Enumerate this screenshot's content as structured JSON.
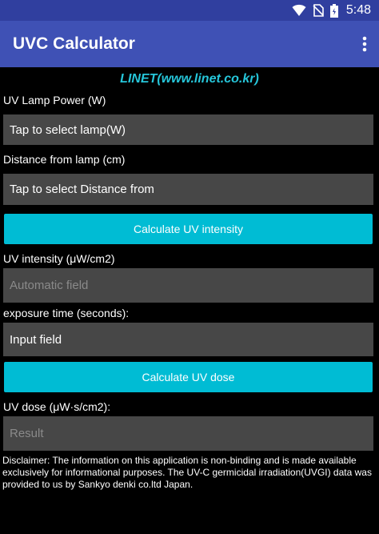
{
  "status_bar": {
    "time": "5:48",
    "icons": [
      "wifi-icon",
      "no-sim-icon",
      "battery-icon"
    ]
  },
  "app_bar": {
    "title": "UVC Calculator",
    "menu_icon": "more-vert-icon"
  },
  "header_link": "LINET(www.linet.co.kr)",
  "lamp_power": {
    "label": "UV Lamp Power (W)",
    "value": "Tap to select lamp(W)"
  },
  "distance": {
    "label": "Distance from lamp (cm)",
    "value": "Tap to select Distance from"
  },
  "calc_intensity_button": "Calculate UV intensity",
  "intensity": {
    "label": "UV intensity (μW/cm2)",
    "placeholder": "Automatic field"
  },
  "exposure": {
    "label": "exposure time (seconds):",
    "value": "Input field"
  },
  "calc_dose_button": "Calculate UV dose",
  "dose": {
    "label": "UV dose (μW·s/cm2):",
    "placeholder": "Result"
  },
  "disclaimer": "Disclaimer: The information on this application is non-binding and is made available exclusively for informational purposes. The UV-C germicidal irradiation(UVGI) data was provided to us by Sankyo denki co.ltd Japan.",
  "colors": {
    "status_bar": "#303f9f",
    "app_bar": "#3f51b5",
    "accent": "#00bcd4",
    "link": "#26c6da",
    "field_bg": "#474747"
  }
}
